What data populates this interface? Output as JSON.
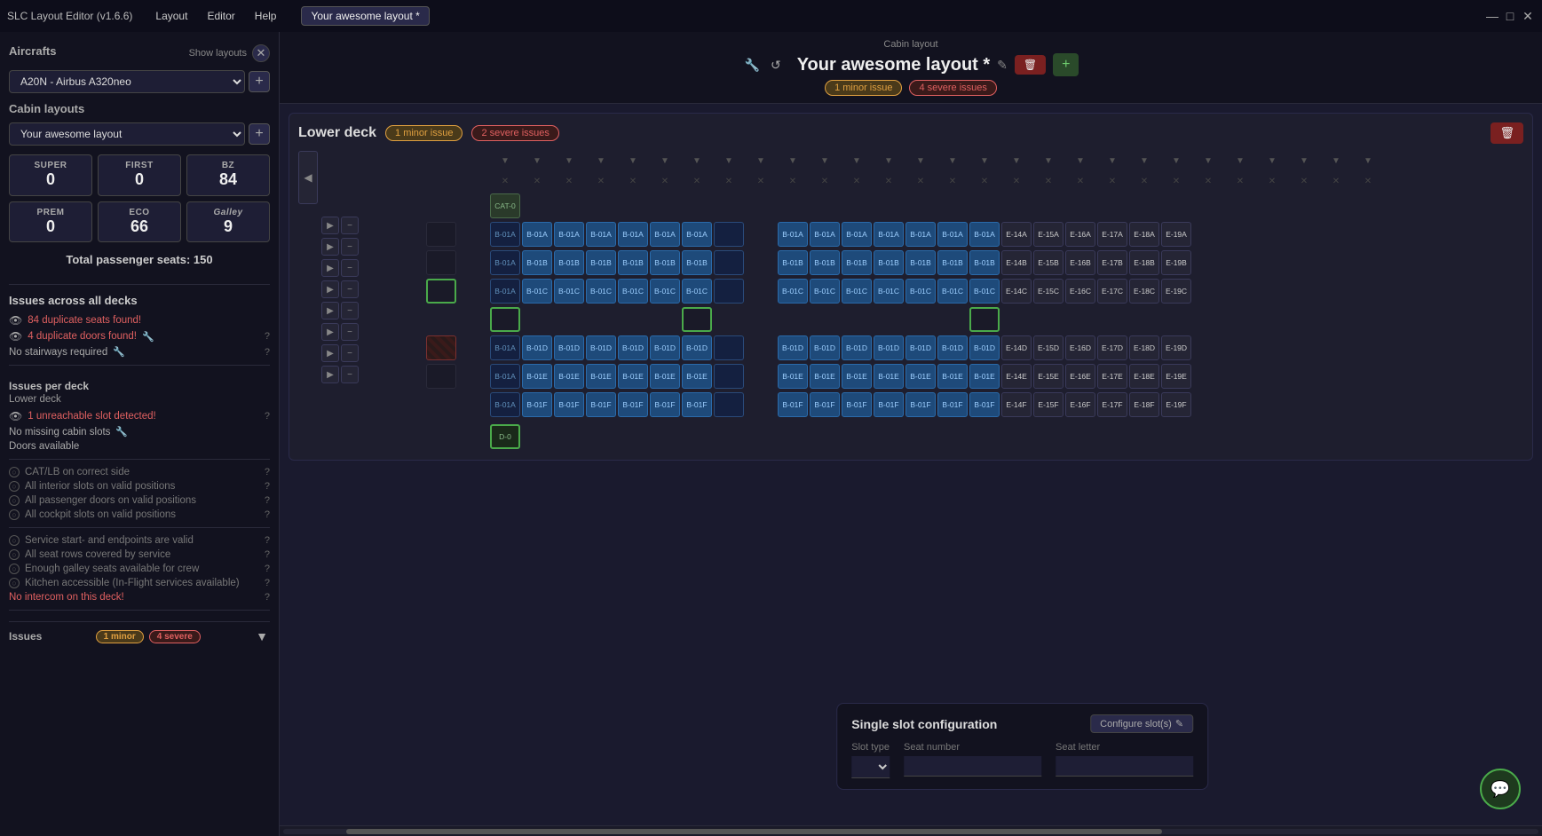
{
  "app": {
    "title": "SLC Layout Editor (v1.6.6)",
    "menus": [
      "Layout",
      "Editor",
      "Help"
    ],
    "active_tab": "Your awesome layout *"
  },
  "window_controls": {
    "minimize": "—",
    "maximize": "□",
    "close": "✕"
  },
  "sidebar": {
    "aircrafts_label": "Aircrafts",
    "show_layouts_label": "Show layouts",
    "aircraft_selected": "A20N - Airbus A320neo",
    "cabin_layouts_label": "Cabin layouts",
    "cabin_layout_selected": "Your awesome layout",
    "seat_classes": [
      {
        "label": "SUPER",
        "value": "0"
      },
      {
        "label": "FIRST",
        "value": "0"
      },
      {
        "label": "BZ",
        "value": "84"
      },
      {
        "label": "PREM",
        "value": "0"
      },
      {
        "label": "ECO",
        "value": "66"
      },
      {
        "label": "Galley",
        "value": "9",
        "italic": true
      }
    ],
    "total_seats_label": "Total passenger seats: 150",
    "issues_across_all_decks_label": "Issues across all decks",
    "issues": [
      {
        "text": "84 duplicate seats found!",
        "type": "error",
        "has_eye": true
      },
      {
        "text": "4 duplicate doors found!",
        "type": "error",
        "has_eye": true,
        "has_wrench": true,
        "has_help": true
      },
      {
        "text": "No stairways required",
        "type": "normal",
        "has_eye": false,
        "has_wrench": true,
        "has_help": true
      }
    ],
    "issues_per_deck_label": "Issues per deck",
    "lower_deck_label": "Lower deck",
    "lower_deck_issues": [
      {
        "text": "1 unreachable slot detected!",
        "type": "error",
        "has_eye": true,
        "has_help": true
      },
      {
        "text": "No missing cabin slots",
        "type": "normal",
        "has_wrench": true
      },
      {
        "text": "Doors available",
        "type": "normal"
      }
    ],
    "checks": [
      {
        "text": "CAT/LB on correct side",
        "has_help": true
      },
      {
        "text": "All interior slots on valid positions",
        "has_help": true
      },
      {
        "text": "All passenger doors on valid positions",
        "has_help": true
      },
      {
        "text": "All cockpit slots on valid positions",
        "has_help": true
      }
    ],
    "valid_checks": [
      {
        "text": "Service start- and endpoints are valid",
        "has_help": true
      },
      {
        "text": "All seat rows covered by service",
        "has_help": true
      },
      {
        "text": "Enough galley seats available for crew",
        "has_help": true
      },
      {
        "text": "Kitchen accessible (In-Flight services available)",
        "has_help": true
      },
      {
        "text": "No intercom on this deck!",
        "type": "error",
        "has_help": true
      }
    ],
    "issues_footer_label": "Issues",
    "issues_footer_badge": "1 minor, 4 severe"
  },
  "cabin_header": {
    "label": "Cabin layout",
    "title": "Your awesome layout *",
    "minor_badge": "1 minor issue",
    "severe_badge": "4 severe issues"
  },
  "lower_deck": {
    "title": "Lower deck",
    "minor_badge": "1 minor issue",
    "severe_badge": "2 severe issues",
    "special_slots": [
      "CAT-0",
      "D-0"
    ]
  },
  "slot_config": {
    "title": "Single slot configuration",
    "configure_label": "Configure slot(s)",
    "fields": {
      "slot_type_label": "Slot type",
      "seat_number_label": "Seat number",
      "seat_letter_label": "Seat letter"
    }
  }
}
